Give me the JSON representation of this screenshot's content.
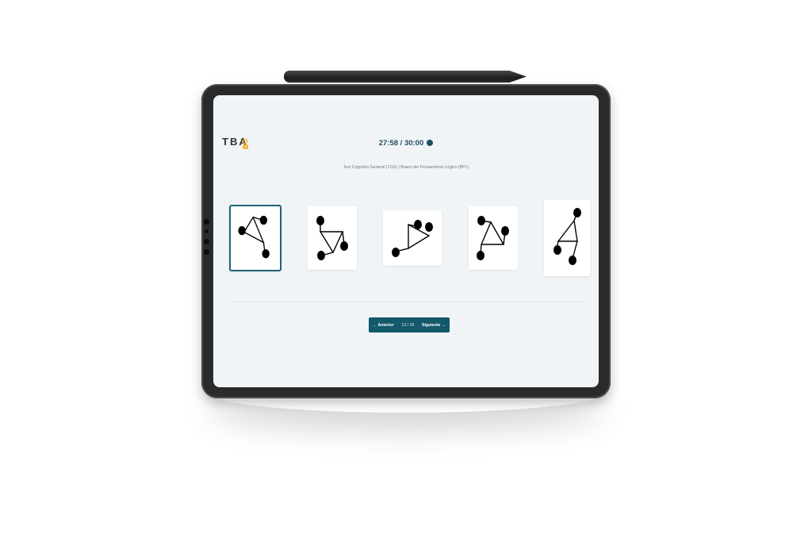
{
  "header": {
    "logo_text": "TBA",
    "timer": "27:58 / 30:00",
    "subtitle": "Test Cognitivo General (TCG) | Bases del Pensamiento Lógico (BPL)"
  },
  "options": [
    {
      "id": "a",
      "selected": true
    },
    {
      "id": "b",
      "selected": false
    },
    {
      "id": "c",
      "selected": false
    },
    {
      "id": "d",
      "selected": false
    },
    {
      "id": "e",
      "selected": false
    }
  ],
  "navigation": {
    "prev_label": "← Anterior",
    "progress": "13 / 29",
    "next_label": "Siguiente →"
  },
  "colors": {
    "accent": "#13586b",
    "screen_bg": "#f1f4f7",
    "logo_accent": "#f2b233"
  },
  "icons": [
    "timer-icon",
    "arrow-left-icon",
    "arrow-right-icon"
  ]
}
